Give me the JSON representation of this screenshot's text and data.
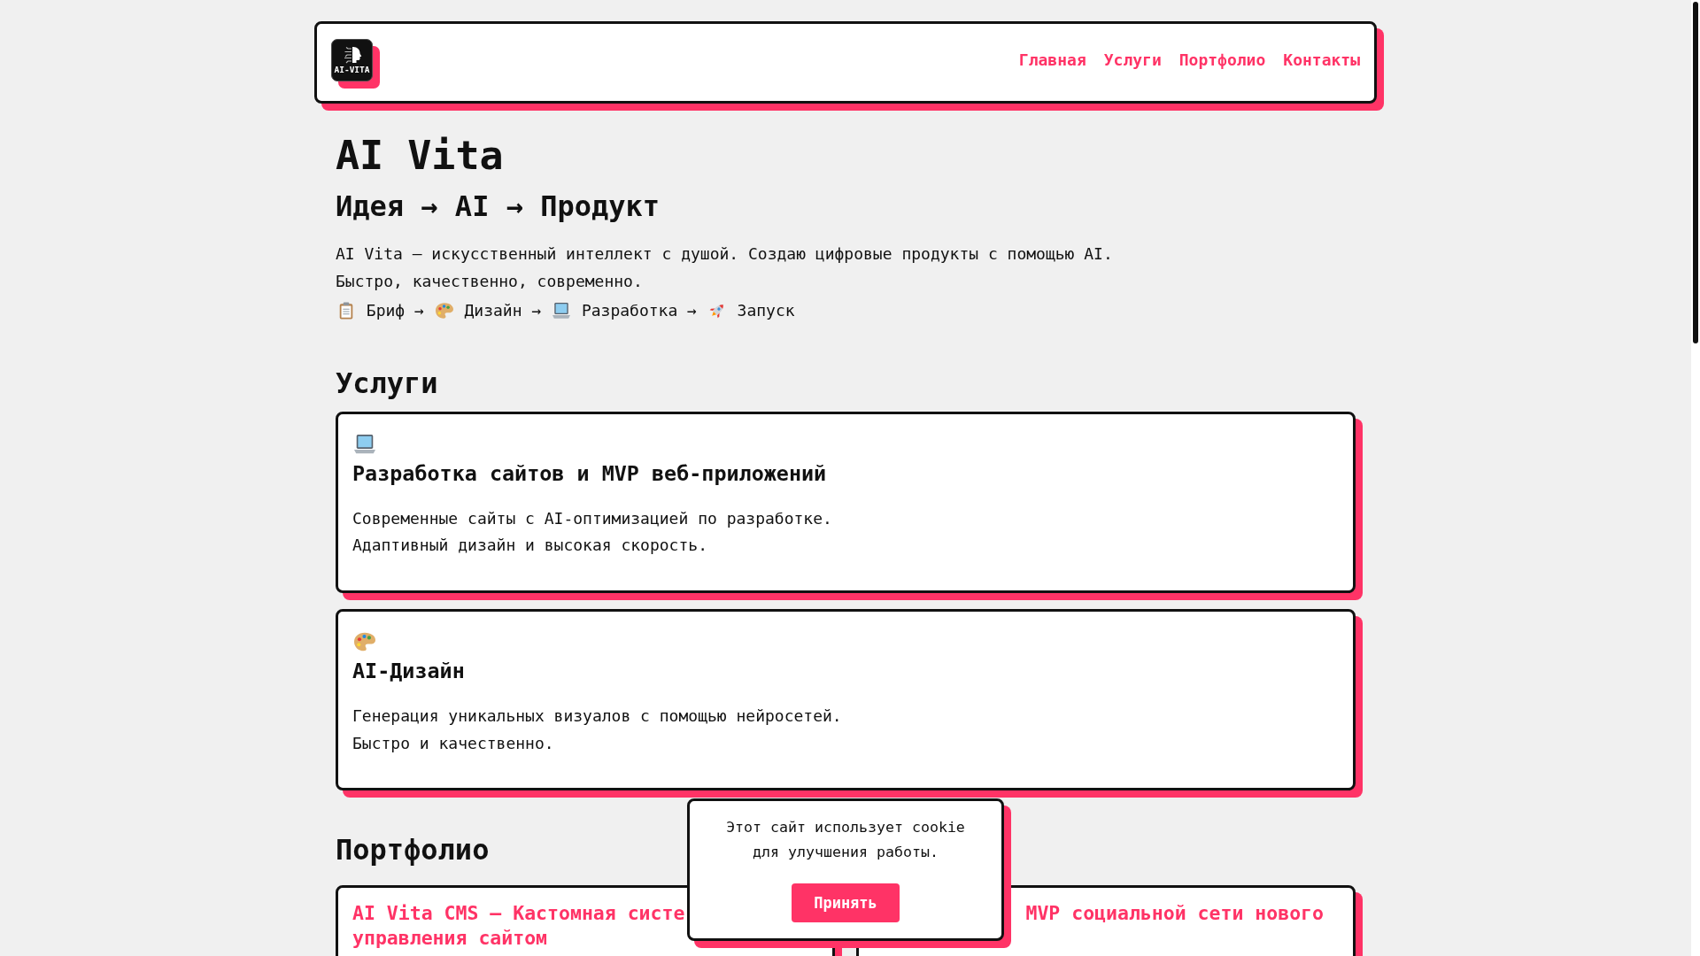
{
  "header": {
    "logo_text": "AI-VITA",
    "nav": [
      "Главная",
      "Услуги",
      "Портфолио",
      "Контакты"
    ]
  },
  "hero": {
    "title": "AI Vita",
    "subtitle": "Идея → AI → Продукт",
    "description": [
      "AI Vita — искусственный интеллект с душой. Создаю цифровые продукты с помощью AI.",
      "Быстро, качественно, современно."
    ],
    "process": [
      {
        "kind": "clipboard",
        "label": "Бриф",
        "arrow": "→"
      },
      {
        "kind": "palette",
        "label": "Дизайн",
        "arrow": "→"
      },
      {
        "kind": "laptop",
        "label": "Разработка",
        "arrow": "→"
      },
      {
        "kind": "rocket",
        "label": "Запуск"
      }
    ]
  },
  "services": {
    "heading": "Услуги",
    "cards": [
      {
        "kind": "laptop",
        "title": "Разработка сайтов и MVP веб-приложений",
        "text": [
          "Современные сайты с AI-оптимизацией по разработке.",
          "Адаптивный дизайн и высокая скорость."
        ]
      },
      {
        "kind": "palette",
        "title": "AI-Дизайн",
        "text": [
          "Генерация уникальных визуалов с помощью нейросетей.",
          "Быстро и качественно."
        ]
      }
    ]
  },
  "portfolio": {
    "heading": "Портфолио",
    "cards": [
      {
        "title_lines": [
          "AI Vita CMS — Кастомная систе",
          "управления сайтом"
        ]
      },
      {
        "title_lines": [
          "MVP социальной сети нового"
        ]
      }
    ]
  },
  "cookie_banner": {
    "text": "Этот сайт использует cookie для улучшения работы.",
    "button": "Принять"
  }
}
